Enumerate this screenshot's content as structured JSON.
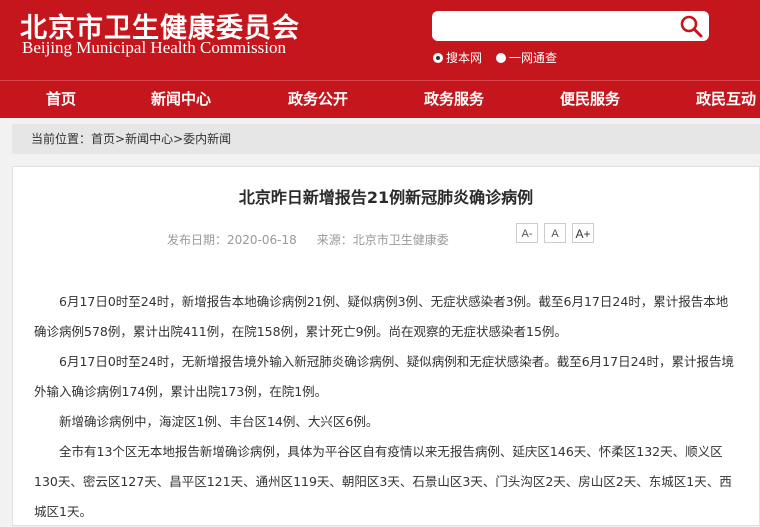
{
  "header": {
    "title_cn": "北京市卫生健康委员会",
    "title_en": "Beijing Municipal Health Commission",
    "search_placeholder": "",
    "scope_options": [
      "搜本网",
      "一网通查"
    ]
  },
  "nav": [
    "首页",
    "新闻中心",
    "政务公开",
    "政务服务",
    "便民服务",
    "政民互动"
  ],
  "breadcrumb": {
    "label": "当前位置：",
    "items": [
      "首页",
      "新闻中心",
      "委内新闻"
    ],
    "sep": ">"
  },
  "article": {
    "title": "北京昨日新增报告21例新冠肺炎确诊病例",
    "date": "发布日期：2020-06-18",
    "source": "来源：北京市卫生健康委",
    "size_buttons": [
      "A-",
      "A",
      "A+"
    ],
    "paragraphs": [
      "6月17日0时至24时，新增报告本地确诊病例21例、疑似病例3例、无症状感染者3例。截至6月17日24时，累计报告本地确诊病例578例，累计出院411例，在院158例，累计死亡9例。尚在观察的无症状感染者15例。",
      "6月17日0时至24时，无新增报告境外输入新冠肺炎确诊病例、疑似病例和无症状感染者。截至6月17日24时，累计报告境外输入确诊病例174例，累计出院173例，在院1例。",
      "新增确诊病例中，海淀区1例、丰台区14例、大兴区6例。",
      "全市有13个区无本地报告新增确诊病例，具体为平谷区自有疫情以来无报告病例、延庆区146天、怀柔区132天、顺义区130天、密云区127天、昌平区121天、通州区119天、朝阳区3天、石景山区3天、门头沟区2天、房山区2天、东城区1天、西城区1天。"
    ]
  }
}
